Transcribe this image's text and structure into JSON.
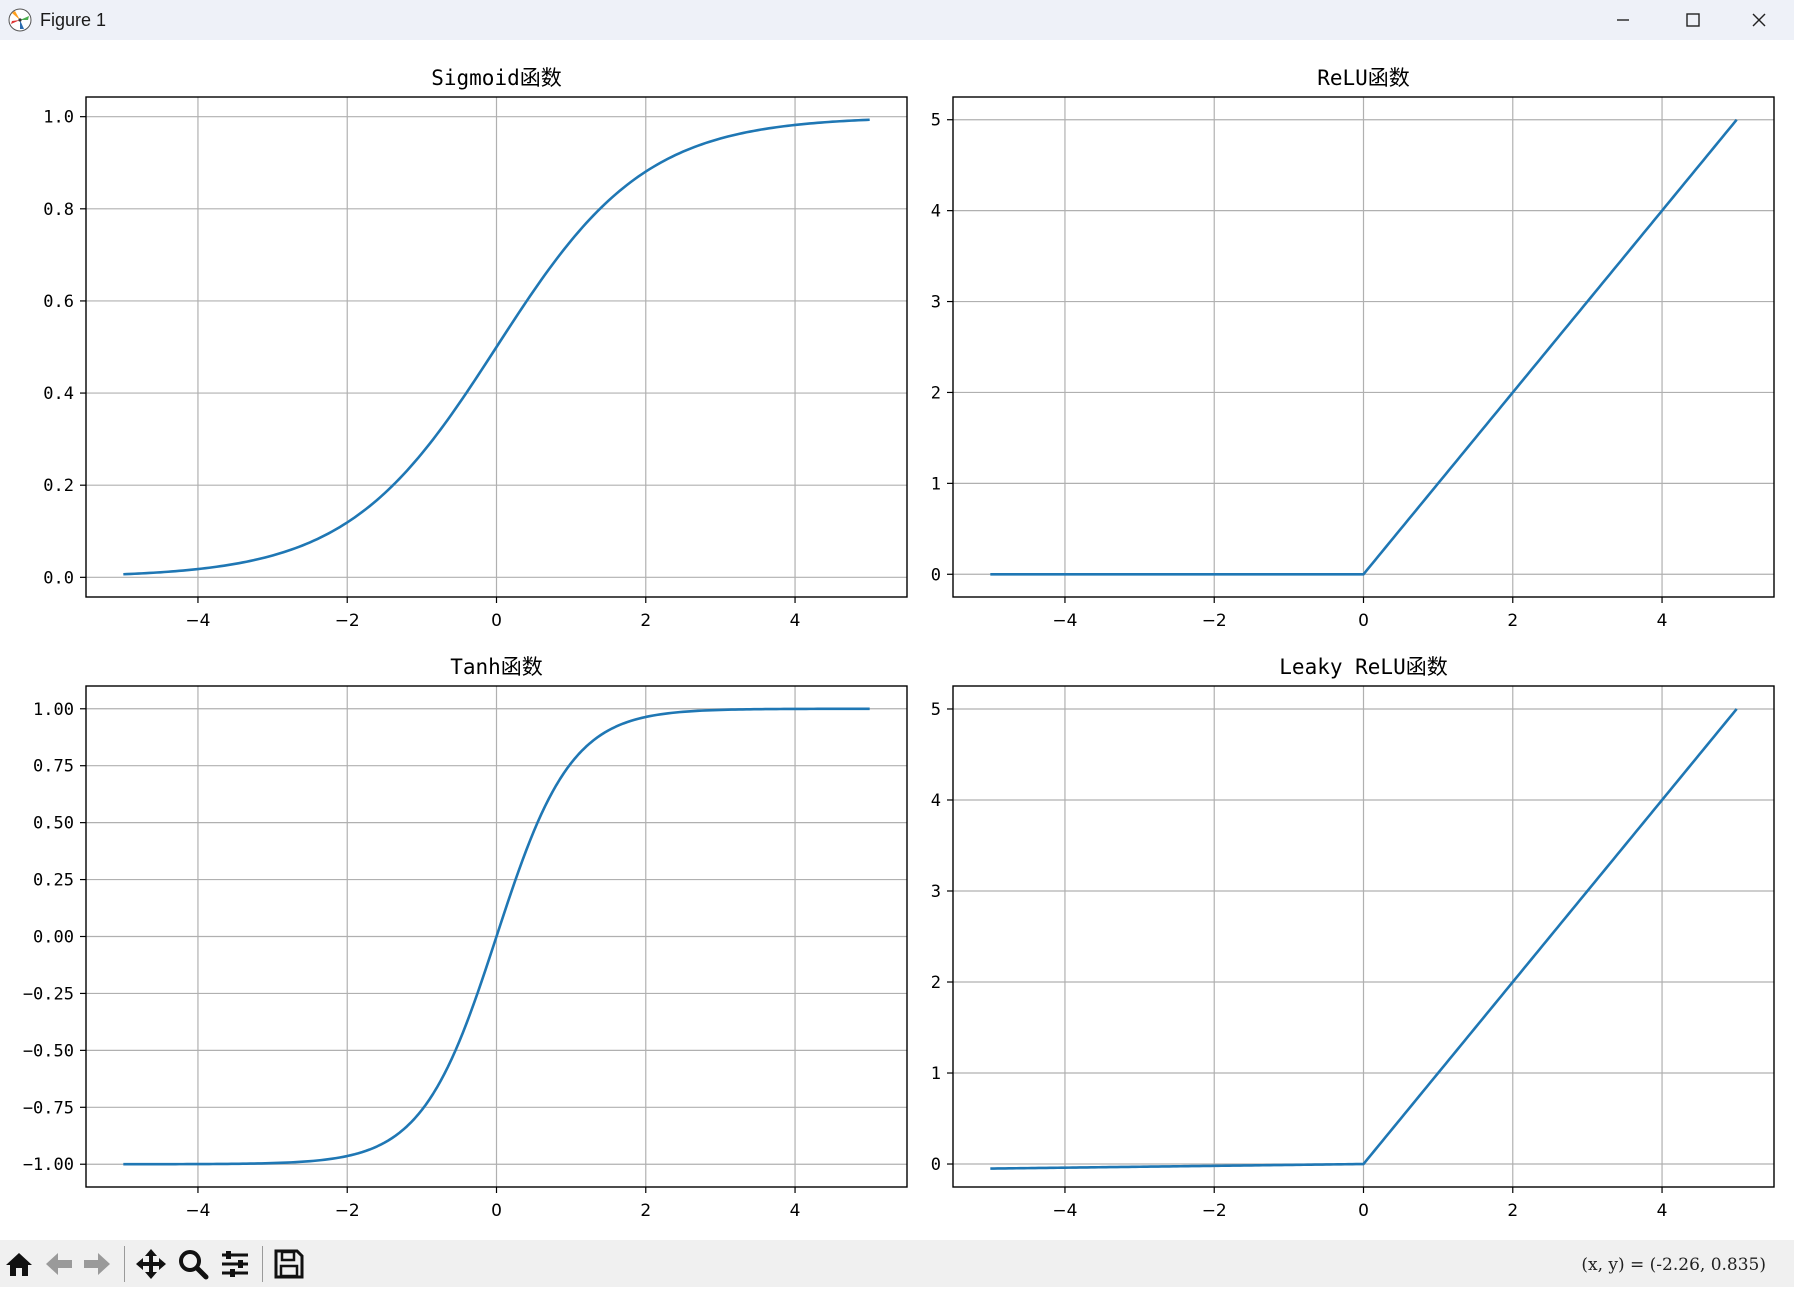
{
  "window": {
    "title": "Figure 1"
  },
  "status": {
    "coords": "(x, y) = (-2.26, 0.835)"
  },
  "toolbar": {
    "buttons": [
      {
        "icon": "home-icon"
      },
      {
        "icon": "back-arrow-icon"
      },
      {
        "icon": "forward-arrow-icon"
      },
      {
        "icon": "pan-move-icon"
      },
      {
        "icon": "zoom-magnifier-icon"
      },
      {
        "icon": "configure-subplots-icon"
      },
      {
        "icon": "save-floppy-icon"
      }
    ]
  },
  "colors": {
    "line": "#1f77b4",
    "grid": "#b0b0b0",
    "axes": "#000000"
  },
  "chart_data": [
    {
      "type": "line",
      "title": "Sigmoid函数",
      "function": "sigmoid",
      "x_range": [
        -5,
        5
      ],
      "x": [
        -5,
        -4,
        -3,
        -2,
        -1,
        0,
        1,
        2,
        3,
        4,
        5
      ],
      "y": [
        0.0067,
        0.018,
        0.0474,
        0.1192,
        0.2689,
        0.5,
        0.7311,
        0.8808,
        0.9526,
        0.982,
        0.9933
      ],
      "xlim": [
        -5.5,
        5.5
      ],
      "ylim": [
        -0.0427,
        1.0427
      ],
      "xticks": [
        -4,
        -2,
        0,
        2,
        4
      ],
      "xticklabels": [
        "−4",
        "−2",
        "0",
        "2",
        "4"
      ],
      "yticks": [
        0,
        0.2,
        0.4,
        0.6,
        0.8,
        1.0
      ],
      "yticklabels": [
        "0.0",
        "0.2",
        "0.4",
        "0.6",
        "0.8",
        "1.0"
      ],
      "grid": true
    },
    {
      "type": "line",
      "title": "ReLU函数",
      "function": "relu",
      "x_range": [
        -5,
        5
      ],
      "x": [
        -5,
        0,
        5
      ],
      "y": [
        0,
        0,
        5
      ],
      "xlim": [
        -5.5,
        5.5
      ],
      "ylim": [
        -0.25,
        5.25
      ],
      "xticks": [
        -4,
        -2,
        0,
        2,
        4
      ],
      "xticklabels": [
        "−4",
        "−2",
        "0",
        "2",
        "4"
      ],
      "yticks": [
        0,
        1,
        2,
        3,
        4,
        5
      ],
      "yticklabels": [
        "0",
        "1",
        "2",
        "3",
        "4",
        "5"
      ],
      "grid": true
    },
    {
      "type": "line",
      "title": "Tanh函数",
      "function": "tanh",
      "x_range": [
        -5,
        5
      ],
      "x": [
        -5,
        -4,
        -3,
        -2,
        -1,
        0,
        1,
        2,
        3,
        4,
        5
      ],
      "y": [
        -0.9999,
        -0.9993,
        -0.9951,
        -0.964,
        -0.7616,
        0,
        0.7616,
        0.964,
        0.9951,
        0.9993,
        0.9999
      ],
      "xlim": [
        -5.5,
        5.5
      ],
      "ylim": [
        -1.1,
        1.1
      ],
      "xticks": [
        -4,
        -2,
        0,
        2,
        4
      ],
      "xticklabels": [
        "−4",
        "−2",
        "0",
        "2",
        "4"
      ],
      "yticks": [
        -1,
        -0.75,
        -0.5,
        -0.25,
        0,
        0.25,
        0.5,
        0.75,
        1
      ],
      "yticklabels": [
        "−1.00",
        "−0.75",
        "−0.50",
        "−0.25",
        "0.00",
        "0.25",
        "0.50",
        "0.75",
        "1.00"
      ],
      "grid": true
    },
    {
      "type": "line",
      "title": "Leaky ReLU函数",
      "function": "leaky_relu",
      "x_range": [
        -5,
        5
      ],
      "x": [
        -5,
        0,
        5
      ],
      "y": [
        -0.05,
        0,
        5
      ],
      "xlim": [
        -5.5,
        5.5
      ],
      "ylim": [
        -0.2525,
        5.2525
      ],
      "xticks": [
        -4,
        -2,
        0,
        2,
        4
      ],
      "xticklabels": [
        "−4",
        "−2",
        "0",
        "2",
        "4"
      ],
      "yticks": [
        0,
        1,
        2,
        3,
        4,
        5
      ],
      "yticklabels": [
        "0",
        "1",
        "2",
        "3",
        "4",
        "5"
      ],
      "grid": true
    }
  ]
}
